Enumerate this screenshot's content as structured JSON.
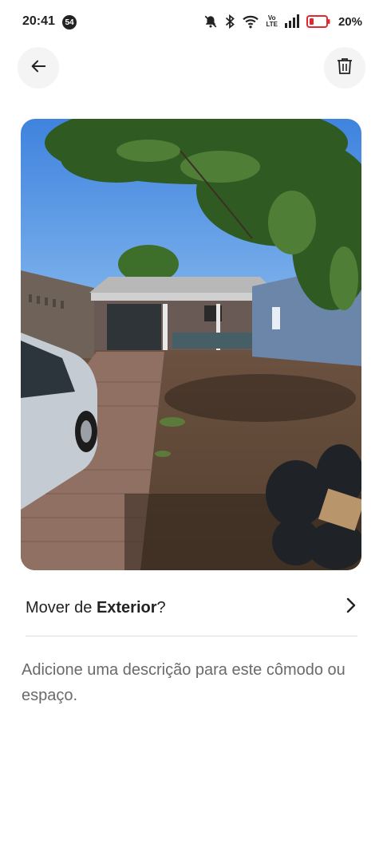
{
  "status_bar": {
    "time": "20:41",
    "notification_count": "54",
    "volte_label_top": "Vo",
    "volte_label_bottom": "LTE",
    "battery_percent": "20%"
  },
  "header": {
    "back_icon": "arrow-left-icon",
    "delete_icon": "trash-icon"
  },
  "photo": {
    "subject": "exterior-house-photo"
  },
  "move_row": {
    "prefix": "Mover de ",
    "room": "Exterior",
    "suffix": "?"
  },
  "description_placeholder": "Adicione uma descrição para este cômodo ou espaço.",
  "colors": {
    "text": "#222222",
    "muted": "#6a6a6a",
    "divider": "#dddddd",
    "button_bg": "#f4f4f4",
    "battery_low": "#e0282e"
  }
}
